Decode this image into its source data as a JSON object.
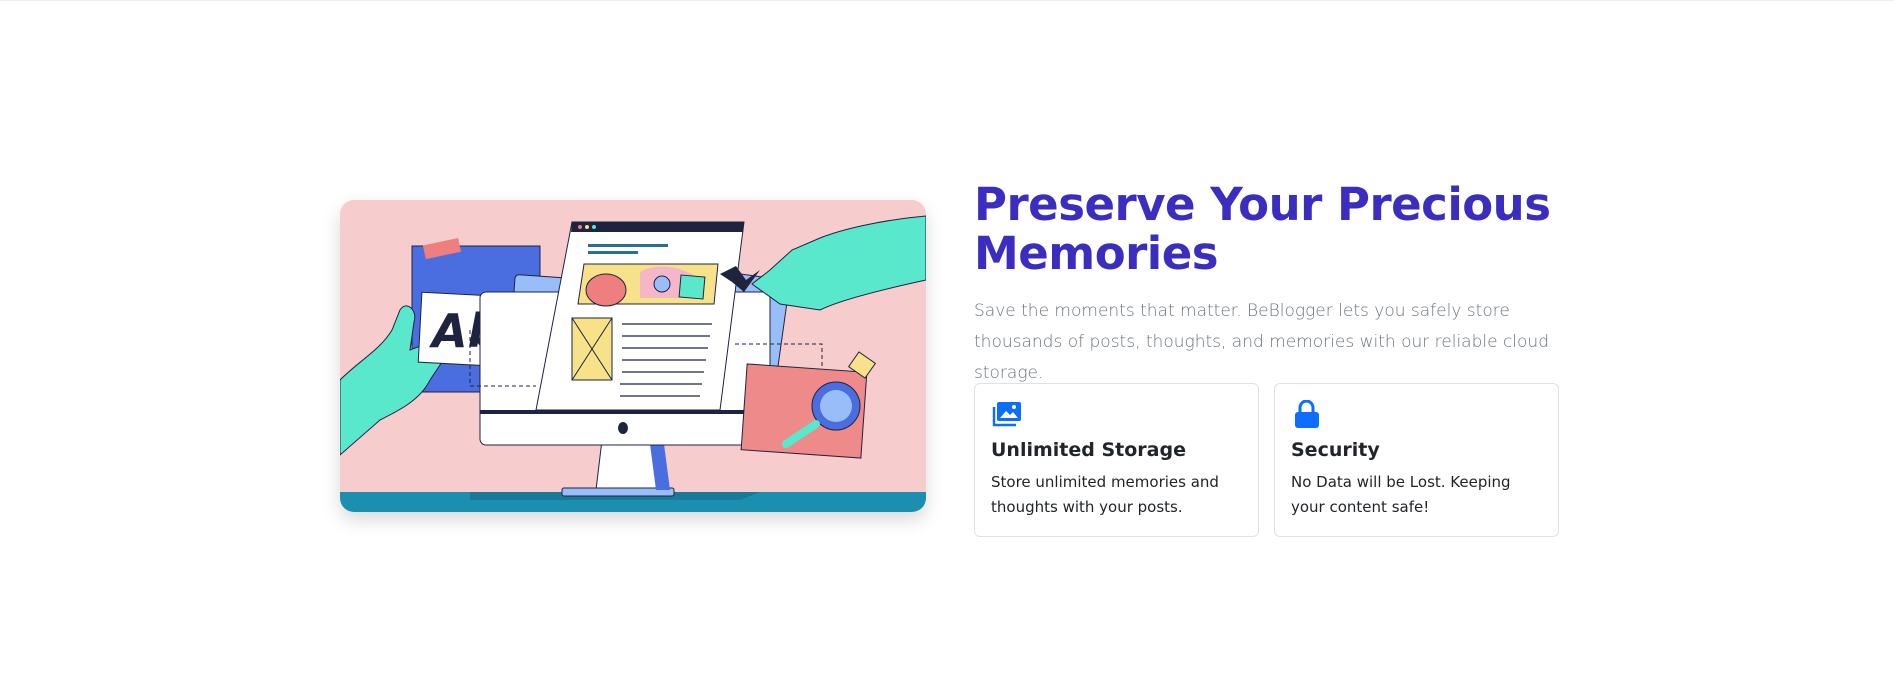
{
  "hero": {
    "title": "Preserve Your Precious Memories",
    "description": "Save the moments that matter. BeBlogger lets you safely store thousands of posts, thoughts, and memories with our reliable cloud storage.",
    "illustration_text": "Ab"
  },
  "features": [
    {
      "icon": "images-icon",
      "title": "Unlimited Storage",
      "text": "Store unlimited memories and thoughts with your posts."
    },
    {
      "icon": "lock-icon",
      "title": "Security",
      "text": "No Data will be Lost. Keeping your content safe!"
    }
  ],
  "colors": {
    "heading": "#3b2dbf",
    "accent": "#0d6efd",
    "muted_text": "#6c757d",
    "illustration_bg": "#f7cccc"
  }
}
